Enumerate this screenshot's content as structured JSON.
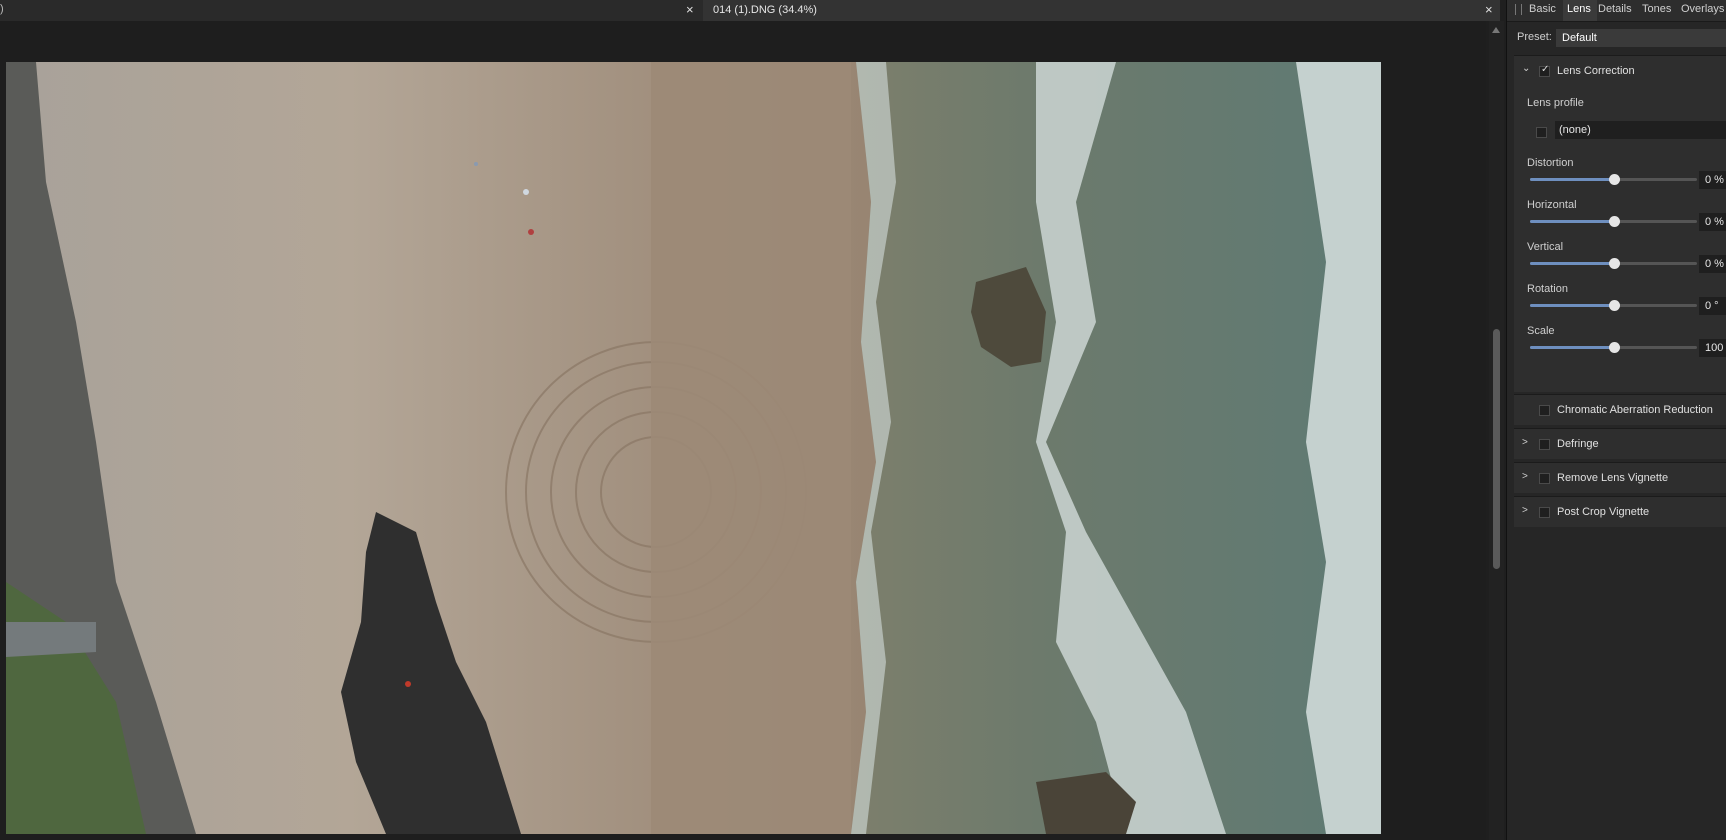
{
  "tabs": {
    "prev": {
      "title_fragment": ")",
      "close": "×"
    },
    "active": {
      "title": "014 (1).DNG (34.4%)",
      "close": "×"
    }
  },
  "panel": {
    "tabs": [
      "Basic",
      "Lens",
      "Details",
      "Tones",
      "Overlays"
    ],
    "active_tab": "Lens",
    "preset": {
      "label": "Preset:",
      "value": "Default"
    },
    "lens_correction": {
      "title": "Lens Correction",
      "checked": true,
      "lens_profile_label": "Lens profile",
      "lens_profile_value": "(none)",
      "sliders": [
        {
          "label": "Distortion",
          "value": "0 %",
          "level": 0.5
        },
        {
          "label": "Horizontal",
          "value": "0 %",
          "level": 0.5
        },
        {
          "label": "Vertical",
          "value": "0 %",
          "level": 0.5
        },
        {
          "label": "Rotation",
          "value": "0 °",
          "level": 0.5
        },
        {
          "label": "Scale",
          "value": "100",
          "level": 0.5
        }
      ]
    },
    "chromatic": {
      "title": "Chromatic Aberration Reduction",
      "checked": false
    },
    "defringe": {
      "title": "Defringe",
      "checked": false
    },
    "remove_vignette": {
      "title": "Remove Lens Vignette",
      "checked": false
    },
    "post_crop": {
      "title": "Post Crop Vignette",
      "checked": false
    }
  },
  "icons": {
    "chevron_down": "chevron-down-icon",
    "chevron_right": "chevron-right-icon",
    "close": "close-icon"
  },
  "colors": {
    "accent": "#6e8fbf",
    "panel_bg": "#262626",
    "section_bg": "#2e2e2e"
  }
}
